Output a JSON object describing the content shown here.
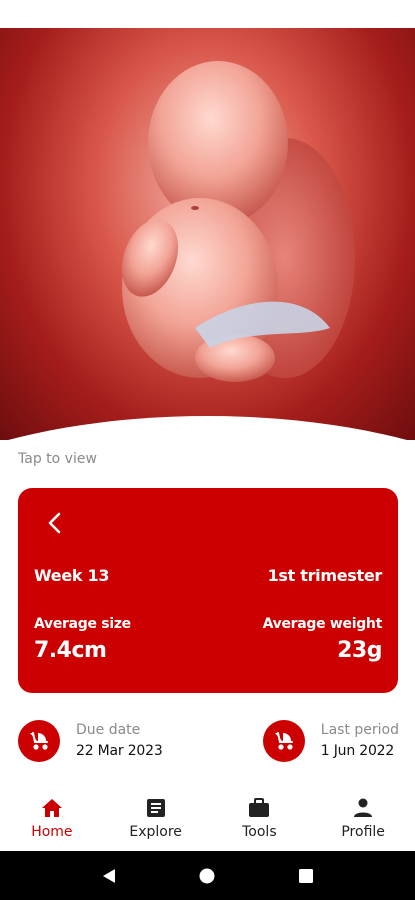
{
  "hero": {
    "image_name": "fetus-illustration",
    "tap_hint": "Tap to view"
  },
  "week_card": {
    "week_label": "Week 13",
    "trimester_label": "1st trimester",
    "size_label": "Average size",
    "weight_label": "Average weight",
    "size_value": "7.4cm",
    "weight_value": "23g",
    "icons": {
      "back": "chevron-left-icon"
    },
    "color": "#cc0000"
  },
  "dates": {
    "due": {
      "label": "Due date",
      "value": "22 Mar 2023",
      "icon": "stroller-icon"
    },
    "last_period": {
      "label": "Last period",
      "value": "1 Jun 2022",
      "icon": "stroller-icon"
    }
  },
  "nav": {
    "items": [
      {
        "label": "Home",
        "icon": "home-icon",
        "active": true
      },
      {
        "label": "Explore",
        "icon": "article-icon",
        "active": false
      },
      {
        "label": "Tools",
        "icon": "briefcase-icon",
        "active": false
      },
      {
        "label": "Profile",
        "icon": "person-icon",
        "active": false
      }
    ],
    "active_color": "#cc0000"
  },
  "system_nav": {
    "icons": [
      "back-triangle-icon",
      "home-circle-icon",
      "recents-square-icon"
    ]
  }
}
